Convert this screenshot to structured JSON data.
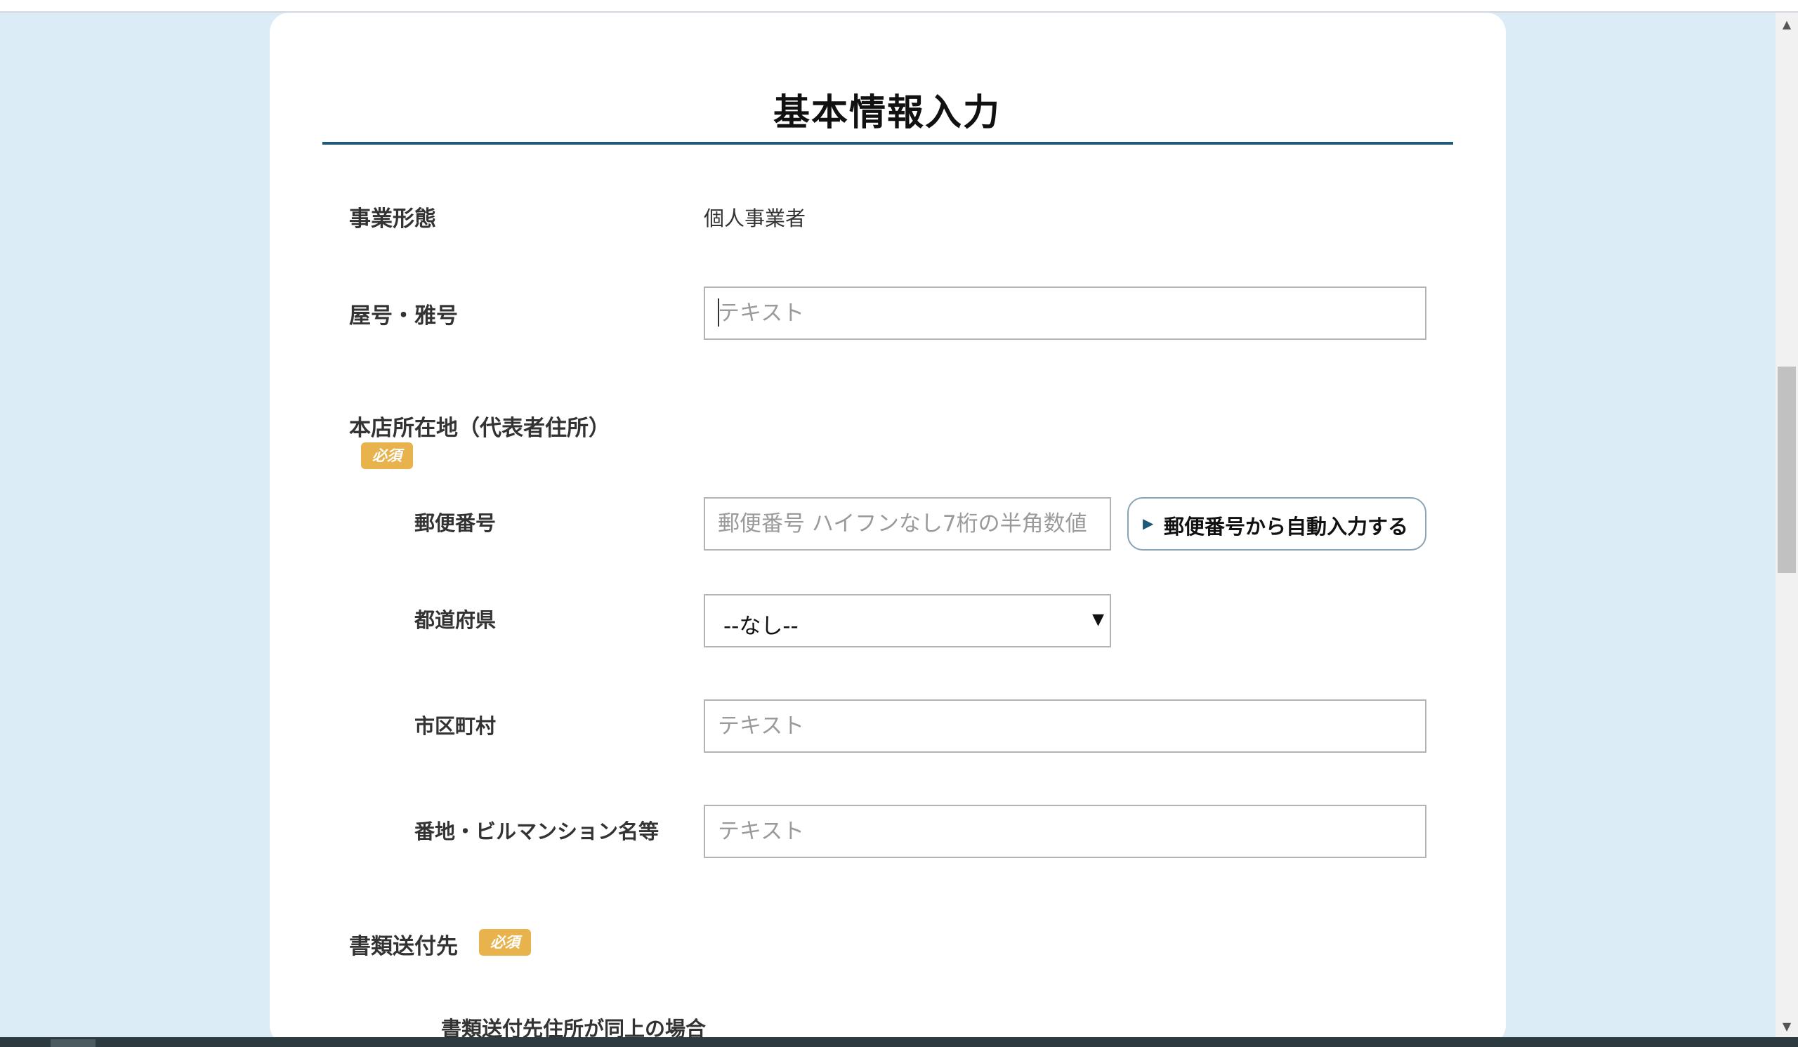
{
  "form": {
    "title": "基本情報入力",
    "business_type": {
      "label": "事業形態",
      "value": "個人事業者"
    },
    "trade_name": {
      "label": "屋号・雅号",
      "placeholder": "テキスト"
    },
    "head_office": {
      "label": "本店所在地（代表者住所）",
      "required_badge": "必須",
      "postal_code": {
        "label": "郵便番号",
        "placeholder": "郵便番号 ハイフンなし7桁の半角数値",
        "autofill_button": "郵便番号から自動入力する"
      },
      "prefecture": {
        "label": "都道府県",
        "selected": "--なし--"
      },
      "city": {
        "label": "市区町村",
        "placeholder": "テキスト"
      },
      "address_detail": {
        "label": "番地・ビルマンション名等",
        "placeholder": "テキスト"
      }
    },
    "document_destination": {
      "label": "書類送付先",
      "required_badge": "必須",
      "same_as_above_label": "書類送付先住所が同上の場合"
    }
  },
  "colors": {
    "page_background": "#dcecf7",
    "title_rule": "#1e5a78",
    "required_badge": "#e8b24c"
  },
  "icons": {
    "autofill_button_icon": "triangle-right",
    "select_arrow": "triangle-down",
    "scroll_up": "triangle-up",
    "scroll_down": "triangle-down"
  }
}
